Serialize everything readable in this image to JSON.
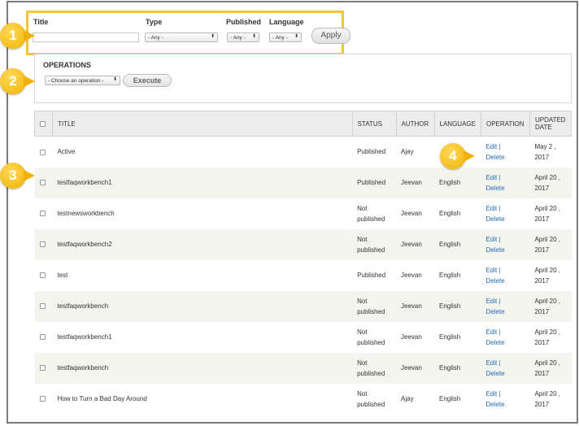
{
  "filters": {
    "title_label": "Title",
    "title_value": "",
    "type_label": "Type",
    "type_value": "- Any -",
    "published_label": "Published",
    "published_value": "- Any -",
    "language_label": "Language",
    "language_value": "- Any -",
    "apply_label": "Apply"
  },
  "operations": {
    "title": "OPERATIONS",
    "select_value": "- Choose an operation -",
    "execute_label": "Execute"
  },
  "table": {
    "headers": [
      "TITLE",
      "STATUS",
      "AUTHOR",
      "LANGUAGE",
      "OPERATION",
      "UPDATED DATE"
    ],
    "rows": [
      {
        "title": "Active",
        "status": "Published",
        "author": "Ajay",
        "language": "",
        "edit": "Edit |",
        "delete": "Delete",
        "date": "May 2 , 2017"
      },
      {
        "title": "testfaqworkbench1",
        "status": "Published",
        "author": "Jeevan",
        "language": "English",
        "edit": "Edit |",
        "delete": "Delete",
        "date": "April 20 , 2017"
      },
      {
        "title": "testnewsworkbench",
        "status": "Not published",
        "author": "Jeevan",
        "language": "English",
        "edit": "Edit |",
        "delete": "Delete",
        "date": "April 20 , 2017"
      },
      {
        "title": "testfaqworkbench2",
        "status": "Not published",
        "author": "Jeevan",
        "language": "English",
        "edit": "Edit |",
        "delete": "Delete",
        "date": "April 20 , 2017"
      },
      {
        "title": "test",
        "status": "Published",
        "author": "Jeevan",
        "language": "English",
        "edit": "Edit |",
        "delete": "Delete",
        "date": "April 20 , 2017"
      },
      {
        "title": "testfaqworkbench",
        "status": "Not published",
        "author": "Jeevan",
        "language": "English",
        "edit": "Edit |",
        "delete": "Delete",
        "date": "April 20 , 2017"
      },
      {
        "title": "testfaqworkbench1",
        "status": "Not published",
        "author": "Jeevan",
        "language": "English",
        "edit": "Edit |",
        "delete": "Delete",
        "date": "April 20 , 2017"
      },
      {
        "title": "testfaqworkbench",
        "status": "Not published",
        "author": "Jeevan",
        "language": "English",
        "edit": "Edit |",
        "delete": "Delete",
        "date": "April 20 , 2017"
      },
      {
        "title": "How to Turn a Bad Day Around",
        "status": "Not published",
        "author": "Ajay",
        "language": "English",
        "edit": "Edit |",
        "delete": "Delete",
        "date": "April 20 , 2017"
      }
    ]
  },
  "callouts": [
    "1",
    "2",
    "3",
    "4"
  ],
  "colors": {
    "highlight_border": "#f2c531",
    "callout": "#f0b100",
    "link": "#1f6bb8",
    "row_alt": "#f3f4ee"
  }
}
